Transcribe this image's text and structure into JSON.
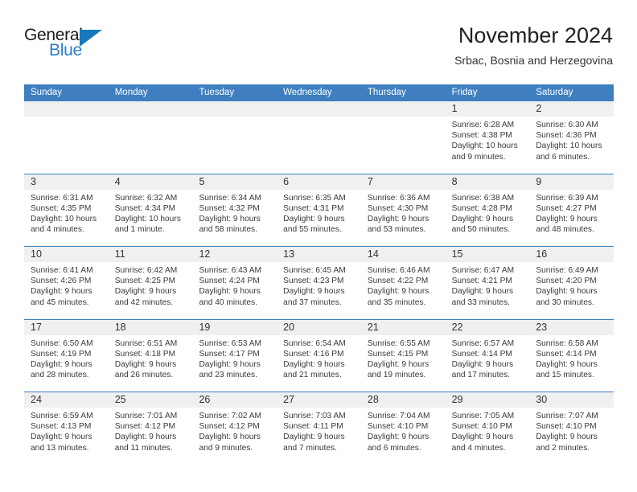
{
  "brand": {
    "name_part1": "General",
    "name_part2": "Blue"
  },
  "header": {
    "title": "November 2024",
    "subtitle": "Srbac, Bosnia and Herzegovina"
  },
  "calendar": {
    "weekdays": [
      "Sunday",
      "Monday",
      "Tuesday",
      "Wednesday",
      "Thursday",
      "Friday",
      "Saturday"
    ],
    "colors": {
      "header_blue": "#3f7fbf",
      "day_band_gray": "#f0f0f0",
      "brand_blue": "#2a7fc9",
      "triangle_blue": "#1878be"
    },
    "weeks": [
      [
        {
          "day": "",
          "empty": true
        },
        {
          "day": "",
          "empty": true
        },
        {
          "day": "",
          "empty": true
        },
        {
          "day": "",
          "empty": true
        },
        {
          "day": "",
          "empty": true
        },
        {
          "day": "1",
          "sunrise": "Sunrise: 6:28 AM",
          "sunset": "Sunset: 4:38 PM",
          "daylight": "Daylight: 10 hours and 9 minutes."
        },
        {
          "day": "2",
          "sunrise": "Sunrise: 6:30 AM",
          "sunset": "Sunset: 4:36 PM",
          "daylight": "Daylight: 10 hours and 6 minutes."
        }
      ],
      [
        {
          "day": "3",
          "sunrise": "Sunrise: 6:31 AM",
          "sunset": "Sunset: 4:35 PM",
          "daylight": "Daylight: 10 hours and 4 minutes."
        },
        {
          "day": "4",
          "sunrise": "Sunrise: 6:32 AM",
          "sunset": "Sunset: 4:34 PM",
          "daylight": "Daylight: 10 hours and 1 minute."
        },
        {
          "day": "5",
          "sunrise": "Sunrise: 6:34 AM",
          "sunset": "Sunset: 4:32 PM",
          "daylight": "Daylight: 9 hours and 58 minutes."
        },
        {
          "day": "6",
          "sunrise": "Sunrise: 6:35 AM",
          "sunset": "Sunset: 4:31 PM",
          "daylight": "Daylight: 9 hours and 55 minutes."
        },
        {
          "day": "7",
          "sunrise": "Sunrise: 6:36 AM",
          "sunset": "Sunset: 4:30 PM",
          "daylight": "Daylight: 9 hours and 53 minutes."
        },
        {
          "day": "8",
          "sunrise": "Sunrise: 6:38 AM",
          "sunset": "Sunset: 4:28 PM",
          "daylight": "Daylight: 9 hours and 50 minutes."
        },
        {
          "day": "9",
          "sunrise": "Sunrise: 6:39 AM",
          "sunset": "Sunset: 4:27 PM",
          "daylight": "Daylight: 9 hours and 48 minutes."
        }
      ],
      [
        {
          "day": "10",
          "sunrise": "Sunrise: 6:41 AM",
          "sunset": "Sunset: 4:26 PM",
          "daylight": "Daylight: 9 hours and 45 minutes."
        },
        {
          "day": "11",
          "sunrise": "Sunrise: 6:42 AM",
          "sunset": "Sunset: 4:25 PM",
          "daylight": "Daylight: 9 hours and 42 minutes."
        },
        {
          "day": "12",
          "sunrise": "Sunrise: 6:43 AM",
          "sunset": "Sunset: 4:24 PM",
          "daylight": "Daylight: 9 hours and 40 minutes."
        },
        {
          "day": "13",
          "sunrise": "Sunrise: 6:45 AM",
          "sunset": "Sunset: 4:23 PM",
          "daylight": "Daylight: 9 hours and 37 minutes."
        },
        {
          "day": "14",
          "sunrise": "Sunrise: 6:46 AM",
          "sunset": "Sunset: 4:22 PM",
          "daylight": "Daylight: 9 hours and 35 minutes."
        },
        {
          "day": "15",
          "sunrise": "Sunrise: 6:47 AM",
          "sunset": "Sunset: 4:21 PM",
          "daylight": "Daylight: 9 hours and 33 minutes."
        },
        {
          "day": "16",
          "sunrise": "Sunrise: 6:49 AM",
          "sunset": "Sunset: 4:20 PM",
          "daylight": "Daylight: 9 hours and 30 minutes."
        }
      ],
      [
        {
          "day": "17",
          "sunrise": "Sunrise: 6:50 AM",
          "sunset": "Sunset: 4:19 PM",
          "daylight": "Daylight: 9 hours and 28 minutes."
        },
        {
          "day": "18",
          "sunrise": "Sunrise: 6:51 AM",
          "sunset": "Sunset: 4:18 PM",
          "daylight": "Daylight: 9 hours and 26 minutes."
        },
        {
          "day": "19",
          "sunrise": "Sunrise: 6:53 AM",
          "sunset": "Sunset: 4:17 PM",
          "daylight": "Daylight: 9 hours and 23 minutes."
        },
        {
          "day": "20",
          "sunrise": "Sunrise: 6:54 AM",
          "sunset": "Sunset: 4:16 PM",
          "daylight": "Daylight: 9 hours and 21 minutes."
        },
        {
          "day": "21",
          "sunrise": "Sunrise: 6:55 AM",
          "sunset": "Sunset: 4:15 PM",
          "daylight": "Daylight: 9 hours and 19 minutes."
        },
        {
          "day": "22",
          "sunrise": "Sunrise: 6:57 AM",
          "sunset": "Sunset: 4:14 PM",
          "daylight": "Daylight: 9 hours and 17 minutes."
        },
        {
          "day": "23",
          "sunrise": "Sunrise: 6:58 AM",
          "sunset": "Sunset: 4:14 PM",
          "daylight": "Daylight: 9 hours and 15 minutes."
        }
      ],
      [
        {
          "day": "24",
          "sunrise": "Sunrise: 6:59 AM",
          "sunset": "Sunset: 4:13 PM",
          "daylight": "Daylight: 9 hours and 13 minutes."
        },
        {
          "day": "25",
          "sunrise": "Sunrise: 7:01 AM",
          "sunset": "Sunset: 4:12 PM",
          "daylight": "Daylight: 9 hours and 11 minutes."
        },
        {
          "day": "26",
          "sunrise": "Sunrise: 7:02 AM",
          "sunset": "Sunset: 4:12 PM",
          "daylight": "Daylight: 9 hours and 9 minutes."
        },
        {
          "day": "27",
          "sunrise": "Sunrise: 7:03 AM",
          "sunset": "Sunset: 4:11 PM",
          "daylight": "Daylight: 9 hours and 7 minutes."
        },
        {
          "day": "28",
          "sunrise": "Sunrise: 7:04 AM",
          "sunset": "Sunset: 4:10 PM",
          "daylight": "Daylight: 9 hours and 6 minutes."
        },
        {
          "day": "29",
          "sunrise": "Sunrise: 7:05 AM",
          "sunset": "Sunset: 4:10 PM",
          "daylight": "Daylight: 9 hours and 4 minutes."
        },
        {
          "day": "30",
          "sunrise": "Sunrise: 7:07 AM",
          "sunset": "Sunset: 4:10 PM",
          "daylight": "Daylight: 9 hours and 2 minutes."
        }
      ]
    ]
  }
}
